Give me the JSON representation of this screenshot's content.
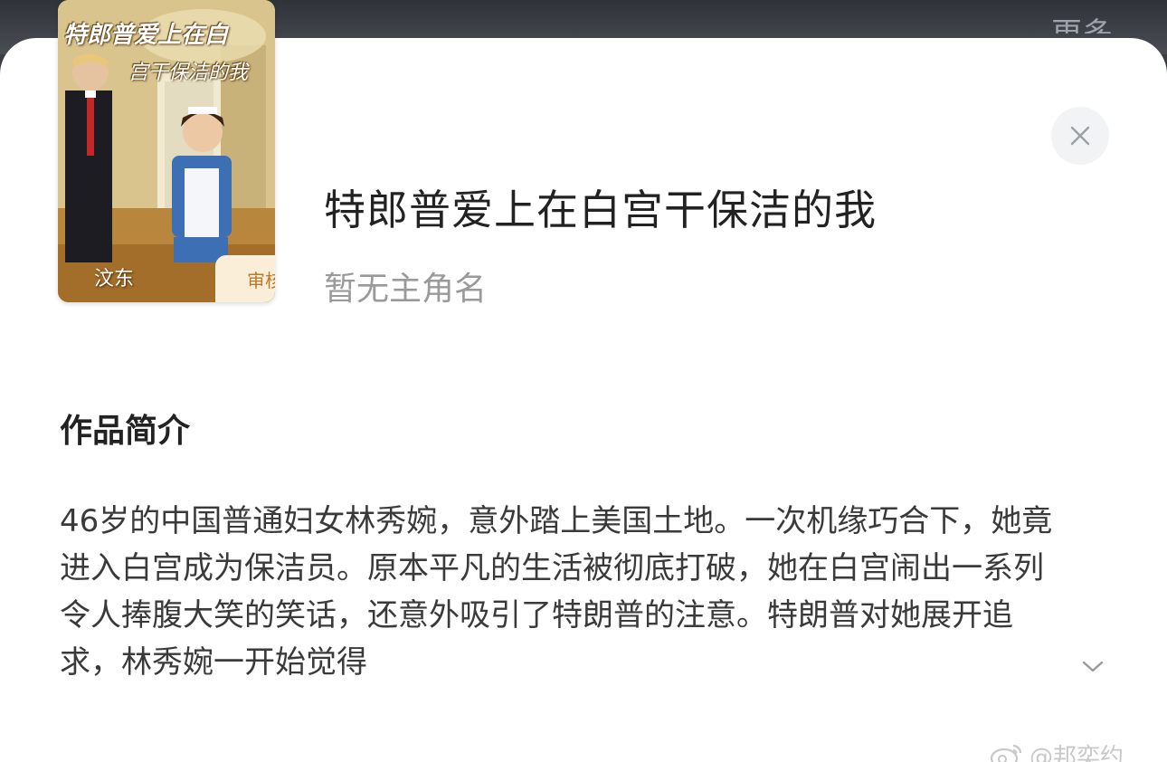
{
  "header": {
    "more_label": "更多"
  },
  "book": {
    "cover_title_line1": "特郎普爱上在白",
    "cover_title_line2": "宫干保洁的我",
    "cover_author": "汶东",
    "status_badge": "审核中",
    "title": "特郎普爱上在白宫干保洁的我",
    "protagonist": "暂无主角名"
  },
  "synopsis": {
    "heading": "作品简介",
    "text": "46岁的中国普通妇女林秀婉，意外踏上美国土地。一次机缘巧合下，她竟进入白宫成为保洁员。原本平凡的生活被彻底打破，她在白宫闹出一系列令人捧腹大笑的笑话，还意外吸引了特朗普的注意。特朗普对她展开追求，林秀婉一开始觉得"
  },
  "watermark": {
    "text": "@邦奕约",
    "icon": "weibo-icon"
  },
  "icons": {
    "close": "close-icon",
    "expand": "chevron-down-icon"
  },
  "colors": {
    "sheet_bg": "#ffffff",
    "title": "#222222",
    "muted": "#9a9a9a",
    "badge_bg": "#fbeed8",
    "badge_text": "#b87a2c"
  }
}
